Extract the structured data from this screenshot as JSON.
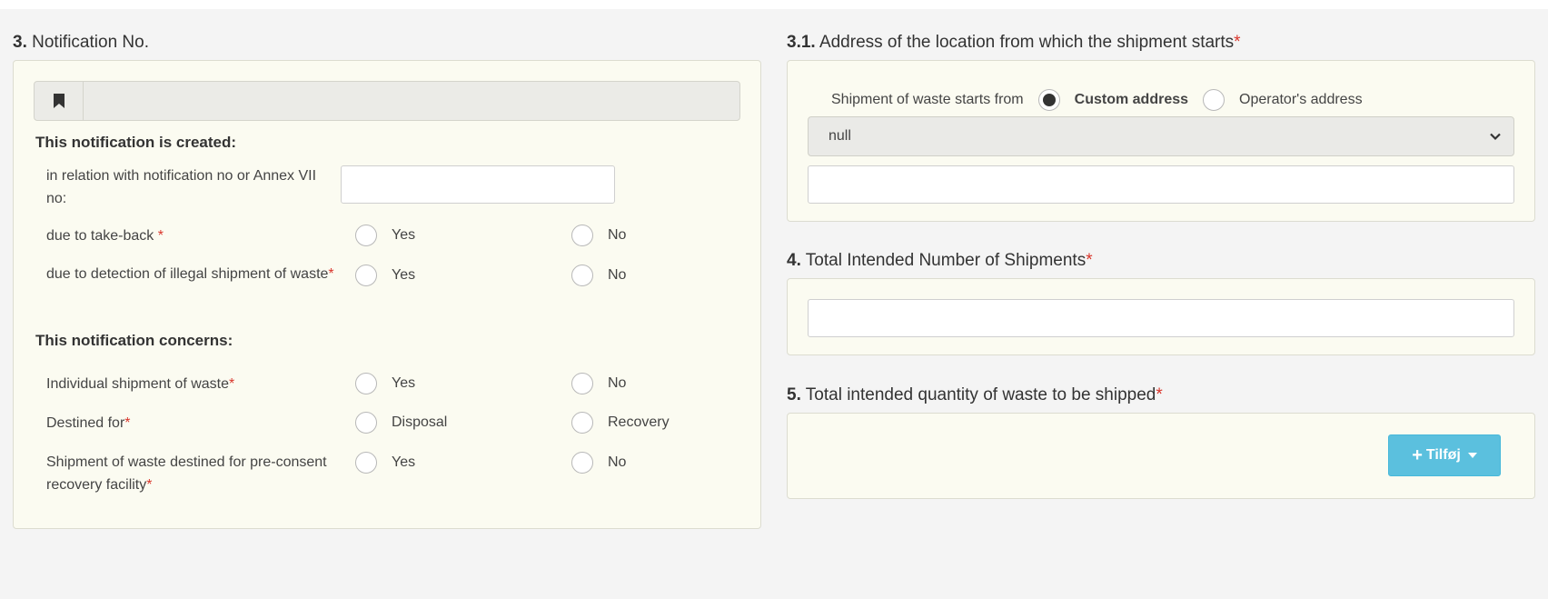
{
  "section3": {
    "number": "3.",
    "title": "Notification No.",
    "created_heading": "This notification is created:",
    "related_label": "in relation with notification no or Annex VII no:",
    "related_value": "",
    "takeback_label": "due to take-back",
    "illegal_label": "due to detection of illegal shipment of waste",
    "concerns_heading": "This notification concerns:",
    "individual_label": "Individual shipment of waste",
    "destined_label": "Destined for",
    "preconsent_label": "Shipment of waste destined for pre-consent recovery facility",
    "yes": "Yes",
    "no": "No",
    "disposal": "Disposal",
    "recovery": "Recovery",
    "required_mark": "*"
  },
  "section31": {
    "number": "3.1.",
    "title": "Address of the location from which the shipment starts",
    "starts_from_label": "Shipment of waste starts from",
    "option_custom": "Custom address",
    "option_operator": "Operator's address",
    "selected_option": "Custom address",
    "select_value": "null",
    "address_value": ""
  },
  "section4": {
    "number": "4.",
    "title": "Total Intended Number of Shipments",
    "value": ""
  },
  "section5": {
    "number": "5.",
    "title": "Total intended quantity of waste to be shipped",
    "add_button": "Tilføj"
  },
  "colors": {
    "panel_background": "#fbfbf1",
    "required": "#d9362c",
    "button_info": "#5bc0de"
  },
  "icons": [
    "bookmark-icon",
    "chevron-down-icon",
    "plus-icon",
    "caret-down-icon"
  ]
}
